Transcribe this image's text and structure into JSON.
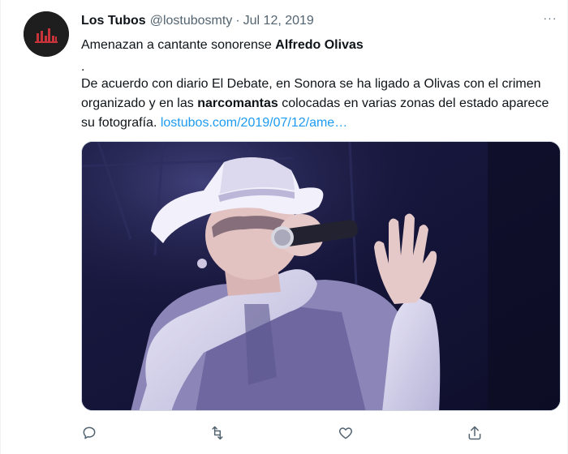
{
  "tweet": {
    "author_name": "Los Tubos",
    "author_handle": "@lostubosmty",
    "separator": "·",
    "date": "Jul 12, 2019",
    "more_label": "···",
    "line1_prefix": "Amenazan a cantante sonorense ",
    "line1_bold": "Alfredo Olivas",
    "dot_line": ".",
    "body_part1": "De acuerdo con diario El Debate, en Sonora se ha ligado a Olivas con el crimen organizado y en las ",
    "body_bold": "narcomantas",
    "body_part2": " colocadas en varias zonas del estado aparece su fotografía. ",
    "link_text": "lostubos.com/2019/07/12/ame…"
  },
  "actions": {
    "reply_icon": "reply-icon",
    "retweet_icon": "retweet-icon",
    "like_icon": "heart-icon",
    "share_icon": "share-icon"
  },
  "colors": {
    "text": "#0f1419",
    "secondary": "#536471",
    "link": "#1d9bf0",
    "border": "#cfd9de"
  }
}
